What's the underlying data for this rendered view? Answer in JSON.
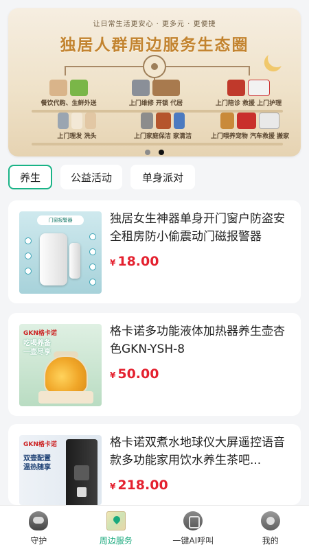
{
  "banner": {
    "subtitle": "让日常生活更安心 · 更多元 · 更便捷",
    "title": "独居人群周边服务生态圈",
    "services": [
      "餐饮代购、生鲜外送",
      "上门维修 开锁 代居",
      "上门陪诊 救援 上门护理",
      "上门理发 洗头",
      "上门家庭保洁 家清洁",
      "上门喂养宠物 汽车救援 搬家"
    ],
    "active_slide": 2,
    "slide_count": 2
  },
  "tabs": [
    {
      "label": "养生",
      "active": true
    },
    {
      "label": "公益活动",
      "active": false
    },
    {
      "label": "单身派对",
      "active": false
    }
  ],
  "products": [
    {
      "title": "独居女生神器单身开门窗户防盗安全租房防小偷震动门磁报警器",
      "currency": "¥",
      "price": "18.00",
      "thumb_text": "门窗报警器"
    },
    {
      "title": "格卡诺多功能液体加热器养生壶杏色GKN-YSH-8",
      "currency": "¥",
      "price": "50.00",
      "thumb_brand": "GKN格卡诺",
      "thumb_slogan": "吃喝养备\n一壶尽享"
    },
    {
      "title": "格卡诺双煮水地球仪大屏遥控语音款多功能家用饮水养生茶吧...",
      "currency": "¥",
      "price": "218.00",
      "thumb_brand": "GKN格卡诺",
      "thumb_slogan": "双壶配置\n温热随享"
    }
  ],
  "bottom_nav": [
    {
      "label": "守护",
      "icon": "shield-icon",
      "active": false
    },
    {
      "label": "周边服务",
      "icon": "map-icon",
      "active": true
    },
    {
      "label": "一键AI呼叫",
      "icon": "phone-call-icon",
      "active": false
    },
    {
      "label": "我的",
      "icon": "user-icon",
      "active": false
    }
  ],
  "colors": {
    "accent": "#19b386",
    "price": "#e4212f",
    "banner_title": "#c2832f"
  }
}
